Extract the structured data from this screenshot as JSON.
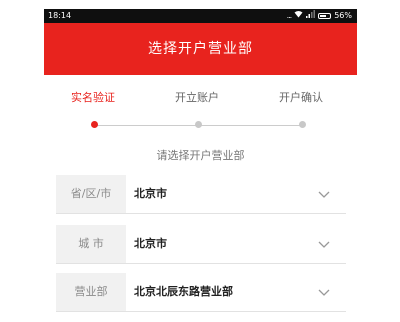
{
  "status_bar": {
    "time": "18:14",
    "dots": "...",
    "battery": "56%"
  },
  "header": {
    "title": "选择开户营业部"
  },
  "steps": [
    {
      "label": "实名验证"
    },
    {
      "label": "开立账户"
    },
    {
      "label": "开户确认"
    }
  ],
  "prompt": "请选择开户营业部",
  "fields": [
    {
      "label": "省/区/市",
      "value": "北京市"
    },
    {
      "label": "城 市",
      "value": "北京市"
    },
    {
      "label": "营业部",
      "value": "北京北辰东路营业部"
    }
  ],
  "colors": {
    "accent": "#e8231e",
    "status_bar": "#0f0f0f"
  },
  "icons": {
    "dropdown": "chevron-down-icon"
  }
}
